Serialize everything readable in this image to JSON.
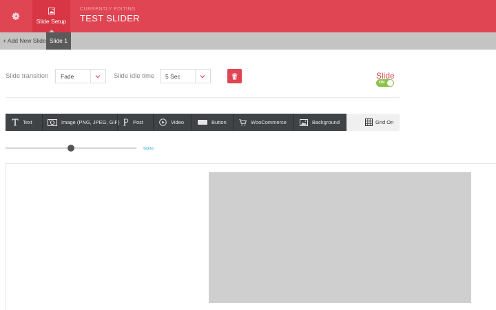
{
  "header": {
    "settings_icon": "gear-icon",
    "setup_tab": {
      "icon": "image-icon",
      "label": "Slide Setup"
    },
    "editing_caption": "CURRENTLY EDITING",
    "slider_name": "TEST SLIDER",
    "accent_color": "#e04553"
  },
  "slides_bar": {
    "add_label": "+ Add New Slide",
    "slides": [
      "Slide 1"
    ],
    "active_slide": "Slide 1"
  },
  "settings": {
    "transition_label": "Slide transition",
    "transition_value": "Fade",
    "idle_label": "Slide idle time",
    "idle_value": "5 Sec",
    "delete_icon": "trash-icon",
    "slide_toggle_label": "Slide",
    "slide_toggle_state": "ON"
  },
  "toolbar": {
    "items": [
      {
        "icon": "text-icon",
        "label": "Text"
      },
      {
        "icon": "camera-icon",
        "label": "Image (PNG, JPEG, GIF)"
      },
      {
        "icon": "post-icon",
        "label": "Post"
      },
      {
        "icon": "play-icon",
        "label": "Video"
      },
      {
        "icon": "button-icon",
        "label": "Button"
      },
      {
        "icon": "cart-icon",
        "label": "WooCommerce"
      },
      {
        "icon": "picture-icon",
        "label": "Background"
      }
    ],
    "grid": {
      "icon": "grid-icon",
      "label": "Grid On"
    }
  },
  "zoom": {
    "value_label": "50%",
    "level": 0.5
  }
}
